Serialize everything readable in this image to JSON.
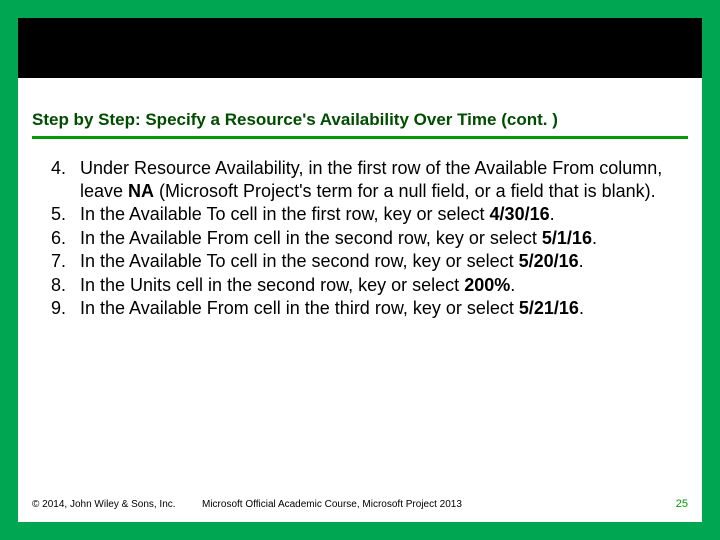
{
  "title": "Step by Step: Specify a Resource's Availability Over Time (cont. )",
  "items": [
    {
      "n": "4.",
      "html": "Under Resource Availability, in the first row of the Available From column, leave <b>NA</b> (Microsoft Project's term for a null field, or a field that is blank)."
    },
    {
      "n": "5.",
      "html": "In the Available To cell in the first row, key or select <b>4/30/16</b>."
    },
    {
      "n": "6.",
      "html": "In the Available From cell in the second row, key or select <b>5/1/16</b>."
    },
    {
      "n": "7.",
      "html": "In the Available To cell in the second row, key or select <b>5/20/16</b>."
    },
    {
      "n": "8.",
      "html": "In the Units cell in the second row, key or select <b>200%</b>."
    },
    {
      "n": "9.",
      "html": "In the Available From cell in the third row, key or select <b>5/21/16</b>."
    }
  ],
  "footer": {
    "copyright": "© 2014, John Wiley & Sons, Inc.",
    "course": "Microsoft Official Academic Course, Microsoft Project 2013",
    "page": "25"
  }
}
